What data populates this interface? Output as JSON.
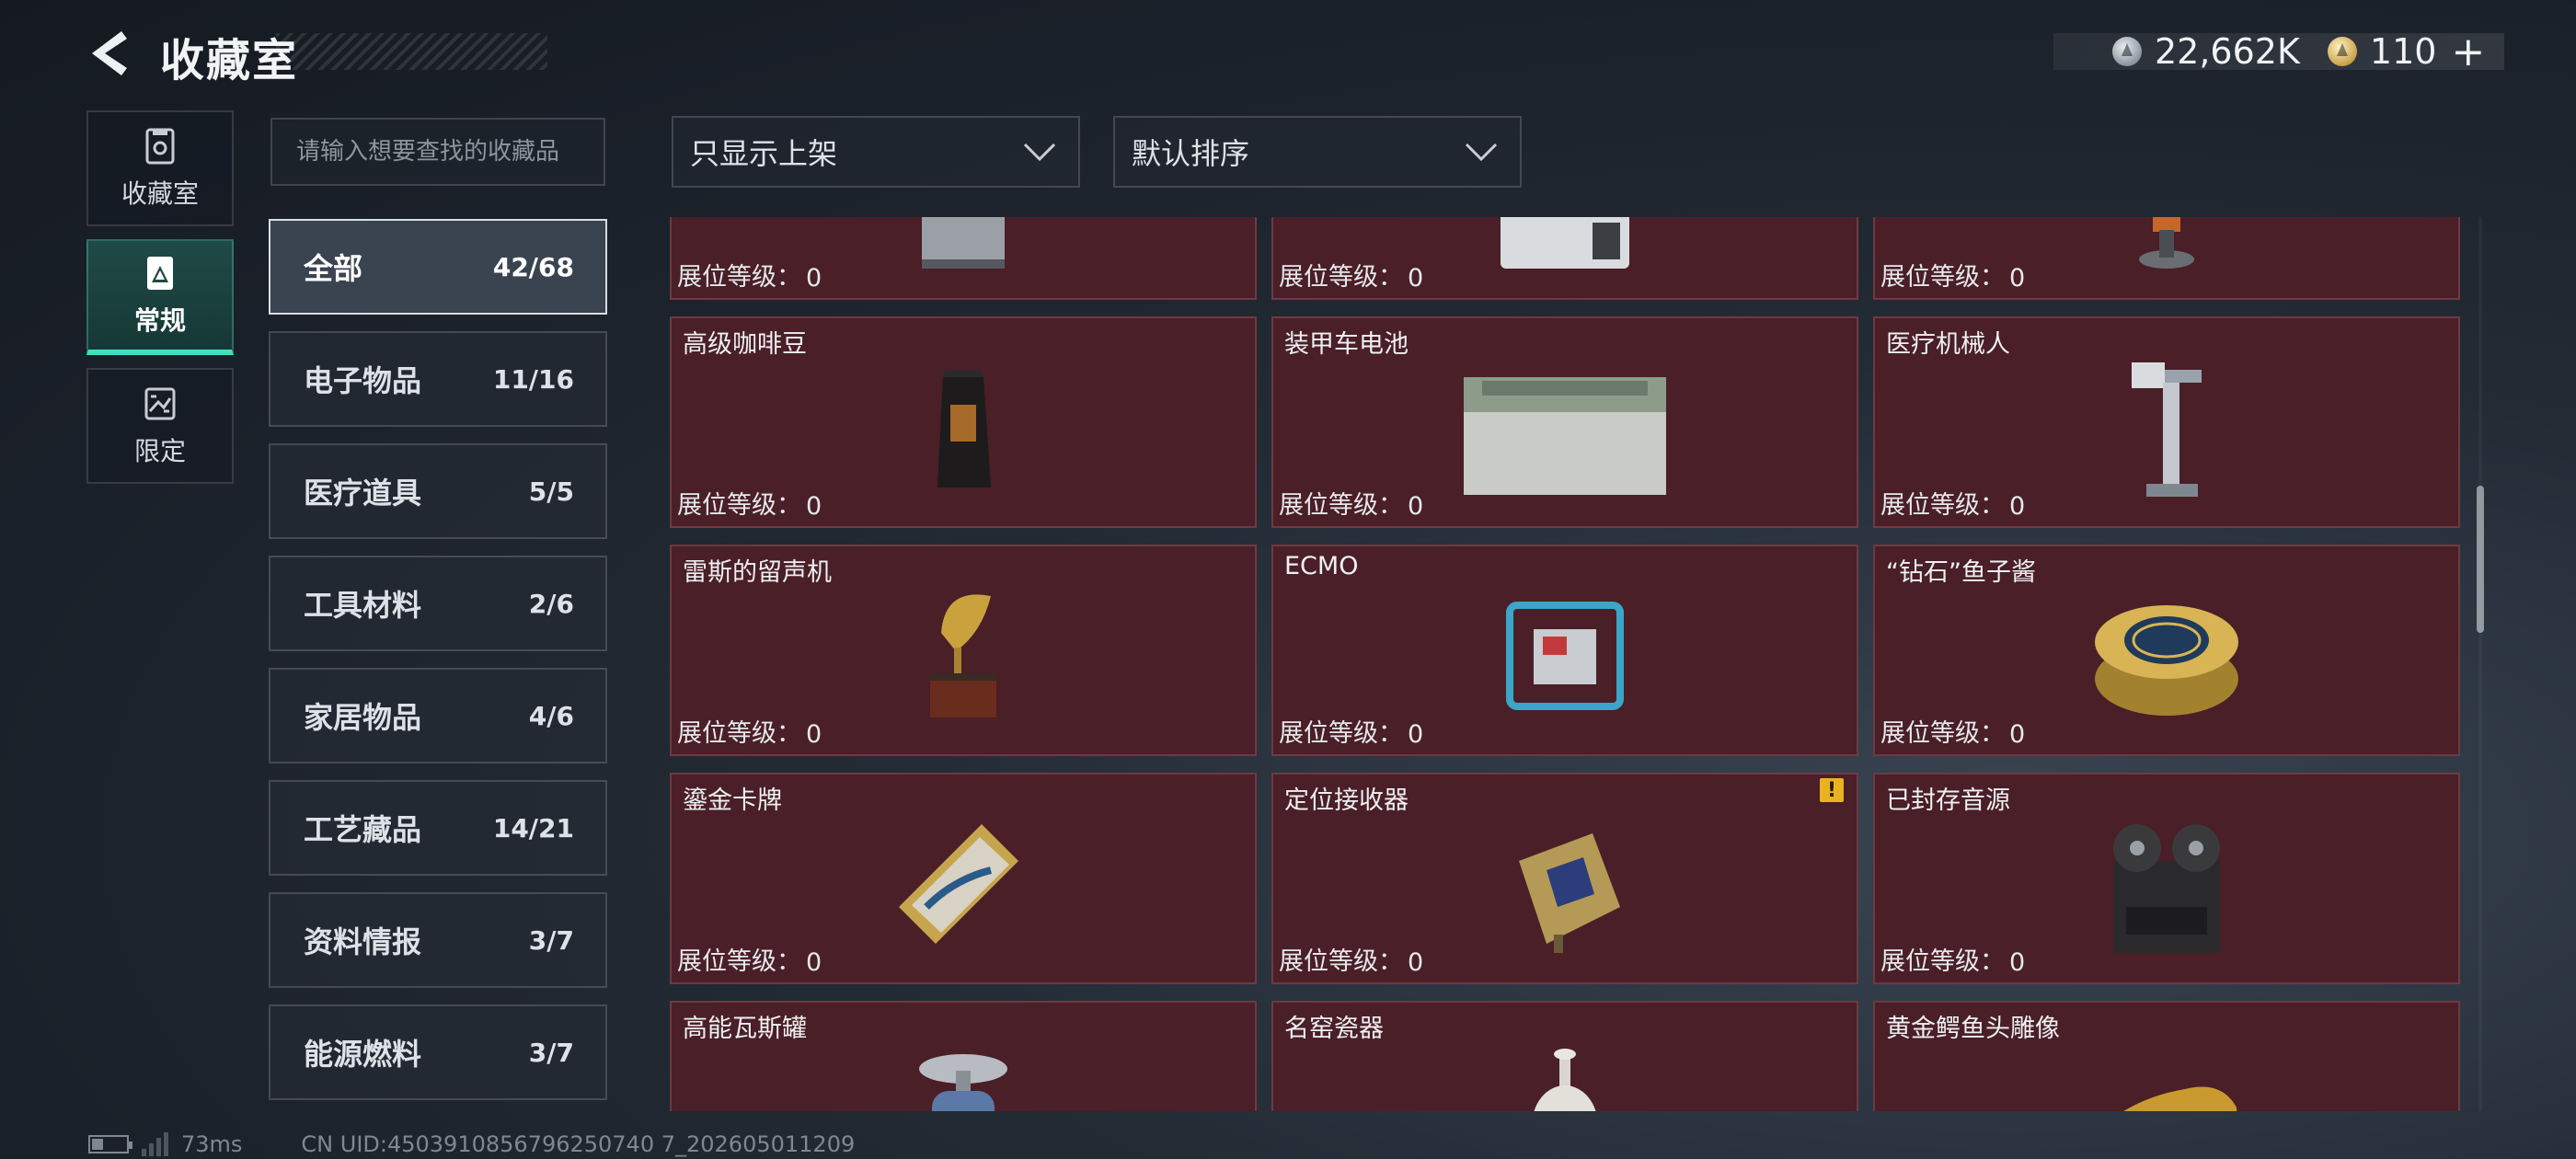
{
  "header": {
    "title": "收藏室",
    "currency": [
      {
        "icon": "silver-coin-icon",
        "value": "22,662K"
      },
      {
        "icon": "gold-coin-icon",
        "value": "110"
      }
    ],
    "plus_label": "+"
  },
  "left_nav": [
    {
      "label": "收藏室",
      "icon": "collection-room-icon"
    },
    {
      "label": "常规",
      "icon": "regular-icon"
    },
    {
      "label": "限定",
      "icon": "limited-icon"
    }
  ],
  "search": {
    "placeholder": "请输入想要查找的收藏品"
  },
  "filters": {
    "display_filter": "只显示上架",
    "sort": "默认排序"
  },
  "categories": [
    {
      "name": "全部",
      "count": "42/68"
    },
    {
      "name": "电子物品",
      "count": "11/16"
    },
    {
      "name": "医疗道具",
      "count": "5/5"
    },
    {
      "name": "工具材料",
      "count": "2/6"
    },
    {
      "name": "家居物品",
      "count": "4/6"
    },
    {
      "name": "工艺藏品",
      "count": "14/21"
    },
    {
      "name": "资料情报",
      "count": "3/7"
    },
    {
      "name": "能源燃料",
      "count": "3/7"
    }
  ],
  "level_label": "展位等级：",
  "items": [
    {
      "name": "",
      "level": "0",
      "icon": "metal-case-icon"
    },
    {
      "name": "",
      "level": "0",
      "icon": "device-icon"
    },
    {
      "name": "",
      "level": "0",
      "icon": "small-device-icon"
    },
    {
      "name": "高级咖啡豆",
      "level": "0",
      "icon": "coffee-bag-icon"
    },
    {
      "name": "装甲车电池",
      "level": "0",
      "icon": "battery-icon"
    },
    {
      "name": "医疗机械人",
      "level": "0",
      "icon": "medical-robot-icon"
    },
    {
      "name": "雷斯的留声机",
      "level": "0",
      "icon": "gramophone-icon"
    },
    {
      "name": "ECMO",
      "level": "0",
      "icon": "ecmo-icon"
    },
    {
      "name": "“钻石”鱼子酱",
      "level": "0",
      "icon": "caviar-tin-icon"
    },
    {
      "name": "鎏金卡牌",
      "level": "0",
      "icon": "gilded-card-icon"
    },
    {
      "name": "定位接收器",
      "level": "0",
      "icon": "locator-receiver-icon",
      "warning": "!"
    },
    {
      "name": "已封存音源",
      "level": "0",
      "icon": "tape-recorder-icon"
    },
    {
      "name": "高能瓦斯罐",
      "level": "",
      "icon": "gas-canister-icon"
    },
    {
      "name": "名窑瓷器",
      "level": "",
      "icon": "porcelain-vase-icon"
    },
    {
      "name": "黄金鳄鱼头雕像",
      "level": "",
      "icon": "gold-croc-head-icon"
    }
  ],
  "footer": {
    "ping": "73ms",
    "uid": "CN UID:4503910856796250740 7_202605011209"
  }
}
